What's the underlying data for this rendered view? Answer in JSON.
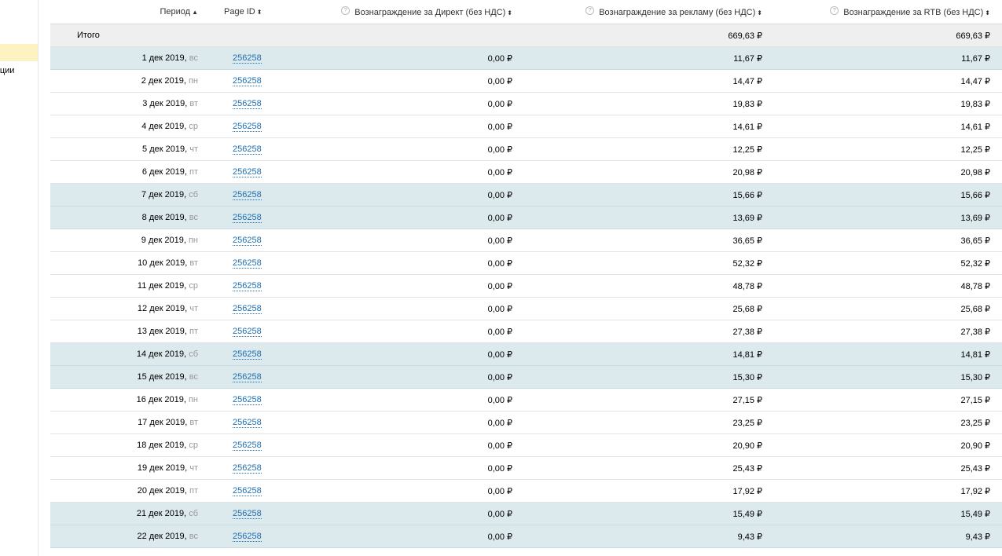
{
  "sidebar": {
    "partial_label": "вации"
  },
  "header": {
    "period": "Период",
    "page_id": "Page ID",
    "direct": "Вознаграждение за Директ (без НДС)",
    "ads": "Вознаграждение за рекламу (без НДС)",
    "rtb": "Вознаграждение за RTB (без НДС)",
    "sort_asc_glyph": "▲",
    "sort_glyph": "⬍",
    "help_glyph": "?"
  },
  "total": {
    "label": "Итого",
    "direct": "",
    "ads": "669,63",
    "rtb": "669,63"
  },
  "currency": "₽",
  "colors": {
    "weekend_row": "#dce9ed",
    "total_row": "#efefef",
    "link": "#1d6fb0",
    "sidebar_highlight": "#fdf2c2"
  },
  "rows": [
    {
      "date": "1 дек 2019,",
      "dow": "вс",
      "page_id": "256258",
      "direct": "0,00",
      "ads": "11,67",
      "rtb": "11,67",
      "weekend": true
    },
    {
      "date": "2 дек 2019,",
      "dow": "пн",
      "page_id": "256258",
      "direct": "0,00",
      "ads": "14,47",
      "rtb": "14,47",
      "weekend": false
    },
    {
      "date": "3 дек 2019,",
      "dow": "вт",
      "page_id": "256258",
      "direct": "0,00",
      "ads": "19,83",
      "rtb": "19,83",
      "weekend": false
    },
    {
      "date": "4 дек 2019,",
      "dow": "ср",
      "page_id": "256258",
      "direct": "0,00",
      "ads": "14,61",
      "rtb": "14,61",
      "weekend": false
    },
    {
      "date": "5 дек 2019,",
      "dow": "чт",
      "page_id": "256258",
      "direct": "0,00",
      "ads": "12,25",
      "rtb": "12,25",
      "weekend": false
    },
    {
      "date": "6 дек 2019,",
      "dow": "пт",
      "page_id": "256258",
      "direct": "0,00",
      "ads": "20,98",
      "rtb": "20,98",
      "weekend": false
    },
    {
      "date": "7 дек 2019,",
      "dow": "сб",
      "page_id": "256258",
      "direct": "0,00",
      "ads": "15,66",
      "rtb": "15,66",
      "weekend": true
    },
    {
      "date": "8 дек 2019,",
      "dow": "вс",
      "page_id": "256258",
      "direct": "0,00",
      "ads": "13,69",
      "rtb": "13,69",
      "weekend": true
    },
    {
      "date": "9 дек 2019,",
      "dow": "пн",
      "page_id": "256258",
      "direct": "0,00",
      "ads": "36,65",
      "rtb": "36,65",
      "weekend": false
    },
    {
      "date": "10 дек 2019,",
      "dow": "вт",
      "page_id": "256258",
      "direct": "0,00",
      "ads": "52,32",
      "rtb": "52,32",
      "weekend": false
    },
    {
      "date": "11 дек 2019,",
      "dow": "ср",
      "page_id": "256258",
      "direct": "0,00",
      "ads": "48,78",
      "rtb": "48,78",
      "weekend": false
    },
    {
      "date": "12 дек 2019,",
      "dow": "чт",
      "page_id": "256258",
      "direct": "0,00",
      "ads": "25,68",
      "rtb": "25,68",
      "weekend": false
    },
    {
      "date": "13 дек 2019,",
      "dow": "пт",
      "page_id": "256258",
      "direct": "0,00",
      "ads": "27,38",
      "rtb": "27,38",
      "weekend": false
    },
    {
      "date": "14 дек 2019,",
      "dow": "сб",
      "page_id": "256258",
      "direct": "0,00",
      "ads": "14,81",
      "rtb": "14,81",
      "weekend": true
    },
    {
      "date": "15 дек 2019,",
      "dow": "вс",
      "page_id": "256258",
      "direct": "0,00",
      "ads": "15,30",
      "rtb": "15,30",
      "weekend": true
    },
    {
      "date": "16 дек 2019,",
      "dow": "пн",
      "page_id": "256258",
      "direct": "0,00",
      "ads": "27,15",
      "rtb": "27,15",
      "weekend": false
    },
    {
      "date": "17 дек 2019,",
      "dow": "вт",
      "page_id": "256258",
      "direct": "0,00",
      "ads": "23,25",
      "rtb": "23,25",
      "weekend": false
    },
    {
      "date": "18 дек 2019,",
      "dow": "ср",
      "page_id": "256258",
      "direct": "0,00",
      "ads": "20,90",
      "rtb": "20,90",
      "weekend": false
    },
    {
      "date": "19 дек 2019,",
      "dow": "чт",
      "page_id": "256258",
      "direct": "0,00",
      "ads": "25,43",
      "rtb": "25,43",
      "weekend": false
    },
    {
      "date": "20 дек 2019,",
      "dow": "пт",
      "page_id": "256258",
      "direct": "0,00",
      "ads": "17,92",
      "rtb": "17,92",
      "weekend": false
    },
    {
      "date": "21 дек 2019,",
      "dow": "сб",
      "page_id": "256258",
      "direct": "0,00",
      "ads": "15,49",
      "rtb": "15,49",
      "weekend": true
    },
    {
      "date": "22 дек 2019,",
      "dow": "вс",
      "page_id": "256258",
      "direct": "0,00",
      "ads": "9,43",
      "rtb": "9,43",
      "weekend": true
    }
  ]
}
